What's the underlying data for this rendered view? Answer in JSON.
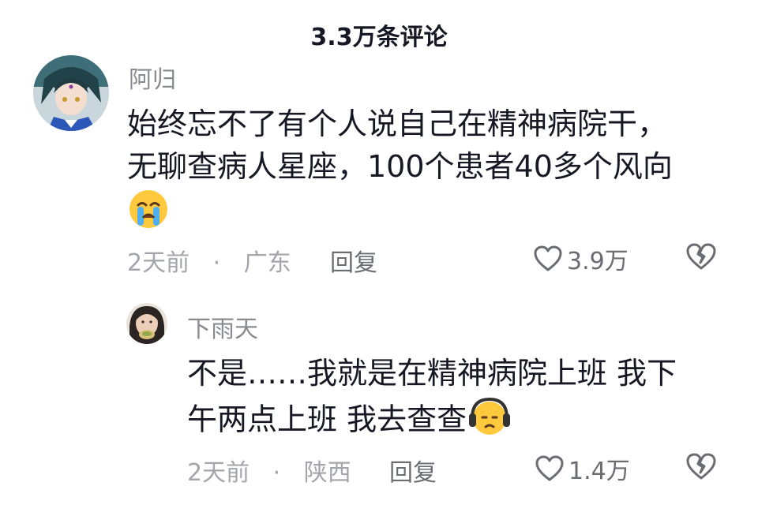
{
  "header": {
    "title": "3.3万条评论"
  },
  "comments": [
    {
      "username": "阿归",
      "lines": [
        "始终忘不了有个人说自己在精神病院干，",
        "无聊查病人星座，100个患者40多个风向"
      ],
      "emoji_icon": "crying-face-icon",
      "time": "2天前",
      "dot": "·",
      "location": "广东",
      "reply_label": "回复",
      "likes": "3.9万"
    },
    {
      "username": "下雨天",
      "lines": [
        "不是……我就是在精神病院上班 我下",
        "午两点上班 我去查查"
      ],
      "emoji_icon": "headphones-face-icon",
      "time": "2天前",
      "dot": "·",
      "location": "陕西",
      "reply_label": "回复",
      "likes": "1.4万"
    }
  ],
  "colors": {
    "text_primary": "#161823",
    "text_secondary": "#8a8b91",
    "text_muted": "#a4a5ab",
    "icon": "#6b6c72"
  }
}
